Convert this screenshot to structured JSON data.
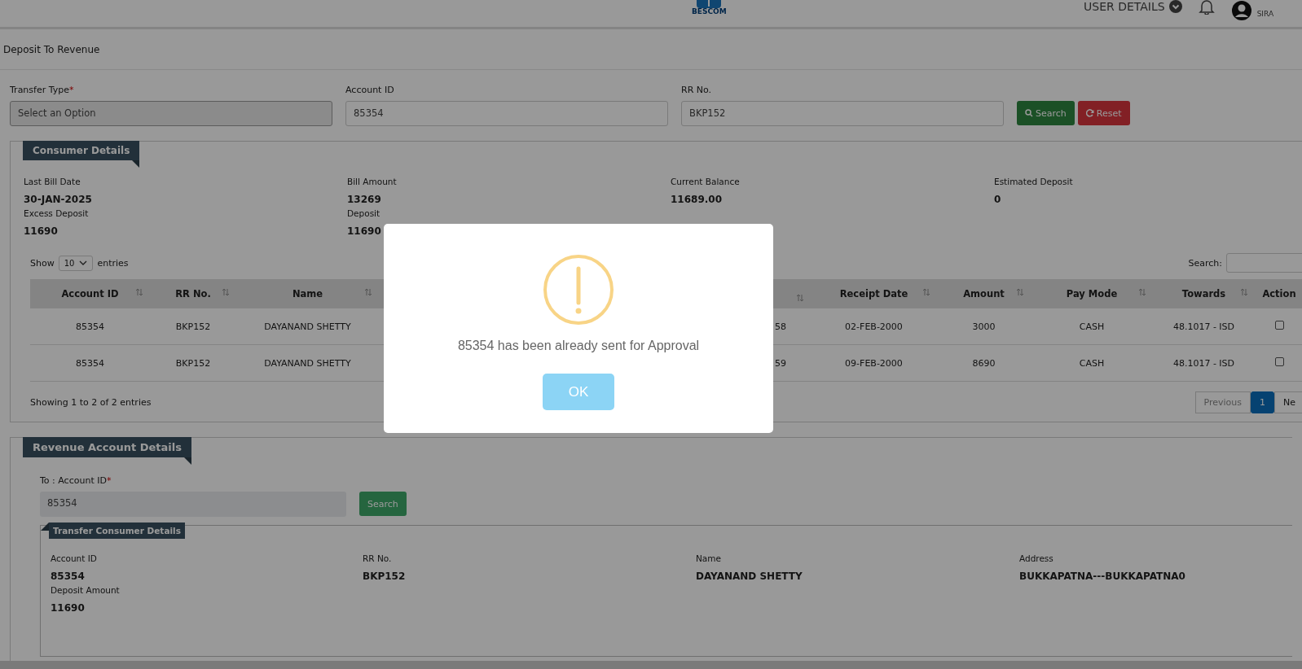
{
  "header": {
    "logo_caption": "BESCOM",
    "user_menu": "USER DETAILS",
    "user_name": "SIRA"
  },
  "page_title": "Deposit To Revenue",
  "filters": [
    {
      "label": "Transfer Type",
      "required_mark": "*",
      "kind": "select",
      "placeholder": "Select an Option"
    },
    {
      "label": "Account ID",
      "kind": "input",
      "value": "85354"
    },
    {
      "label": "RR No.",
      "kind": "input",
      "value": "BKP152"
    }
  ],
  "filter_buttons": [
    {
      "label": "Search",
      "kind": "search"
    },
    {
      "label": "Reset",
      "kind": "reset"
    }
  ],
  "consumer_details": {
    "title": "Consumer Details",
    "fields": [
      {
        "label": "Last Bill Date",
        "value": "30-JAN-2025"
      },
      {
        "label": "Bill Amount",
        "value": "13269"
      },
      {
        "label": "Current Balance",
        "value": "11689.00"
      },
      {
        "label": "Estimated Deposit",
        "value": "0"
      },
      {
        "label": "Excess Deposit",
        "value": "11690"
      },
      {
        "label": "Deposit",
        "value": "11690"
      }
    ],
    "show_label": "Show",
    "page_size": "10",
    "entries_label": "entries",
    "search_label": "Search:",
    "table": {
      "columns": [
        "Account ID",
        "RR No.",
        "Name",
        "",
        "Receipt Date",
        "Amount",
        "Pay Mode",
        "Towards",
        "Action"
      ],
      "rows": [
        {
          "cells": [
            "85354",
            "BKP152",
            "DAYANAND SHETTY",
            "58",
            "02-FEB-2000",
            "3000",
            "CASH",
            "48.1017 - ISD"
          ],
          "checked": false
        },
        {
          "cells": [
            "85354",
            "BKP152",
            "DAYANAND SHETTY",
            "59",
            "09-FEB-2000",
            "8690",
            "CASH",
            "48.1017 - ISD"
          ],
          "checked": false
        }
      ]
    },
    "info": "Showing 1 to 2 of 2 entries",
    "pagination": [
      {
        "label": "Previous",
        "selected": false,
        "disabled": true
      },
      {
        "label": "1",
        "selected": true,
        "disabled": false
      },
      {
        "label": "Ne",
        "selected": false,
        "disabled": false
      }
    ]
  },
  "revenue": {
    "title": "Revenue Account Details",
    "to_label": "To : Account ID",
    "to_required_mark": "*",
    "to_value": "85354",
    "search_button": "Search",
    "transfer_title": "Transfer Consumer Details",
    "fields": [
      {
        "label": "Account ID",
        "value": "85354"
      },
      {
        "label": "RR No.",
        "value": "BKP152"
      },
      {
        "label": "Name",
        "value": "DAYANAND SHETTY"
      },
      {
        "label": "Address",
        "value": "BUKKAPATNA---BUKKAPATNA0"
      },
      {
        "label": "Deposit Amount",
        "value": "11690"
      }
    ]
  },
  "dialog": {
    "message": "85354 has been already sent for Approval",
    "button": "OK"
  }
}
